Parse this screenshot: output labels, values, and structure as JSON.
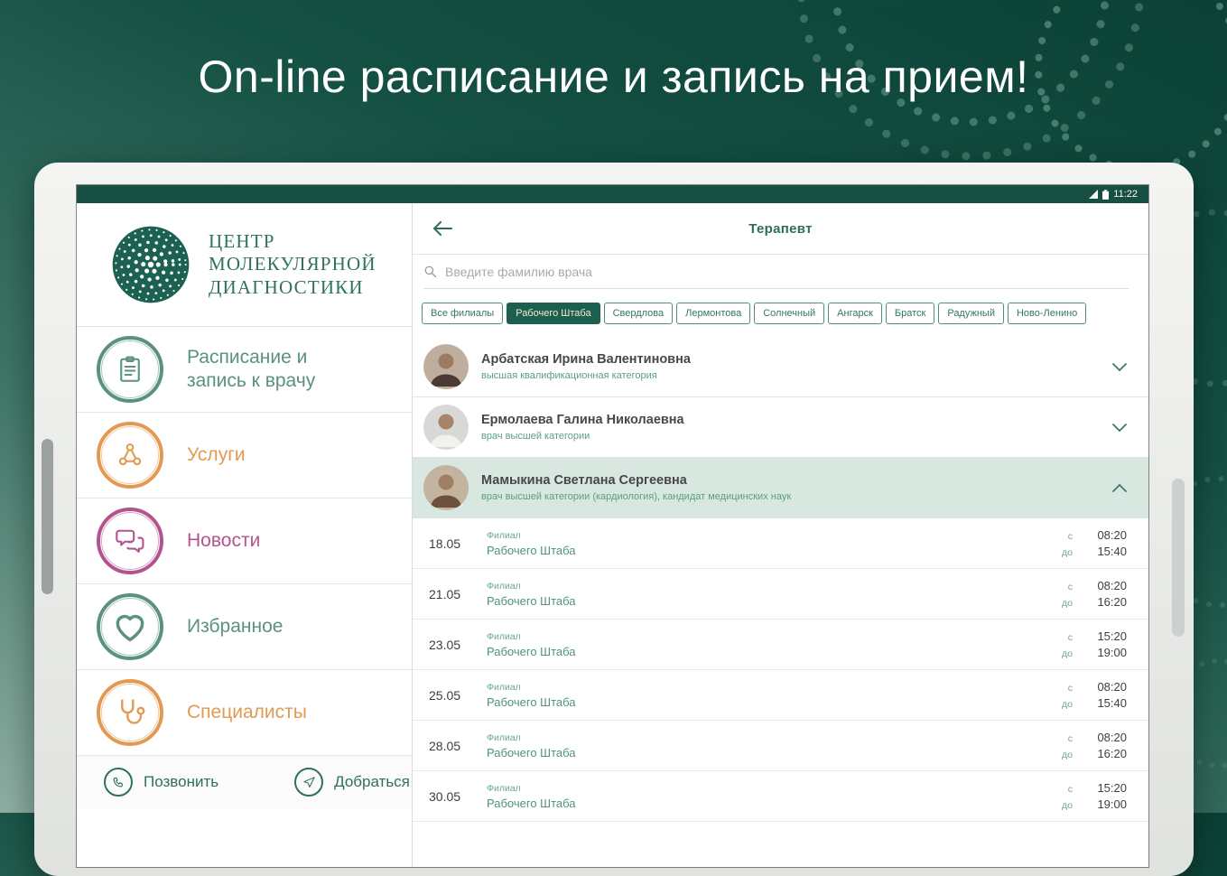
{
  "hero": {
    "title": "On-line расписание и запись на прием!"
  },
  "tablet": {
    "status_bar": {
      "time": "11:22",
      "icons": [
        "signal-icon",
        "battery-icon"
      ]
    }
  },
  "sidebar": {
    "logo": {
      "icon": "molecular-logo-icon",
      "lines": [
        "ЦЕНТР",
        "МОЛЕКУЛЯРНОЙ",
        "ДИАГНОСТИКИ"
      ]
    },
    "items": [
      {
        "label": "Расписание и запись к врачу",
        "icon": "clipboard-icon",
        "color": "#5a9181"
      },
      {
        "label": "Услуги",
        "icon": "molecule-icon",
        "color": "#e29a52"
      },
      {
        "label": "Новости",
        "icon": "chat-bubbles-icon",
        "color": "#b4548e"
      },
      {
        "label": "Избранное",
        "icon": "heart-icon",
        "color": "#5a9181"
      },
      {
        "label": "Специалисты",
        "icon": "stethoscope-icon",
        "color": "#e29a52"
      }
    ],
    "footer": {
      "call": {
        "label": "Позвонить",
        "icon": "phone-icon"
      },
      "directions": {
        "label": "Добраться",
        "icon": "navigate-icon"
      }
    }
  },
  "main": {
    "header": {
      "title": "Терапевт",
      "back_icon": "back-arrow-icon"
    },
    "search": {
      "placeholder": "Введите фамилию врача",
      "icon": "search-icon"
    },
    "filters": [
      {
        "label": "Все филиалы",
        "selected": false
      },
      {
        "label": "Рабочего Штаба",
        "selected": true
      },
      {
        "label": "Свердлова",
        "selected": false
      },
      {
        "label": "Лермонтова",
        "selected": false
      },
      {
        "label": "Солнечный",
        "selected": false
      },
      {
        "label": "Ангарск",
        "selected": false
      },
      {
        "label": "Братск",
        "selected": false
      },
      {
        "label": "Радужный",
        "selected": false
      },
      {
        "label": "Ново-Ленино",
        "selected": false
      }
    ],
    "doctors": [
      {
        "name": "Арбатская Ирина Валентиновна",
        "category": "высшая квалификационная категория",
        "expanded": false
      },
      {
        "name": "Ермолаева Галина Николаевна",
        "category": "врач высшей категории",
        "expanded": false
      },
      {
        "name": "Мамыкина Светлана Сергеевна",
        "category": "врач высшей категории (кардиология), кандидат медицинских наук",
        "expanded": true
      }
    ],
    "schedule": {
      "branch_label": "Филиал",
      "branch_name": "Рабочего Штаба",
      "from_label": "с",
      "to_label": "до",
      "rows": [
        {
          "date": "18.05",
          "from": "08:20",
          "to": "15:40"
        },
        {
          "date": "21.05",
          "from": "08:20",
          "to": "16:20"
        },
        {
          "date": "23.05",
          "from": "15:20",
          "to": "19:00"
        },
        {
          "date": "25.05",
          "from": "08:20",
          "to": "15:40"
        },
        {
          "date": "28.05",
          "from": "08:20",
          "to": "16:20"
        },
        {
          "date": "30.05",
          "from": "15:20",
          "to": "19:00"
        }
      ]
    }
  },
  "theme": {
    "accent_dark": "#1d5f4f",
    "accent_green": "#4f8e7a",
    "chip_selected_text": "#f1ecd2",
    "expanded_row_bg": "#d8e7e0",
    "sidebar_teal": "#5a9181",
    "sidebar_orange": "#e29a52",
    "sidebar_purple": "#b4548e"
  }
}
